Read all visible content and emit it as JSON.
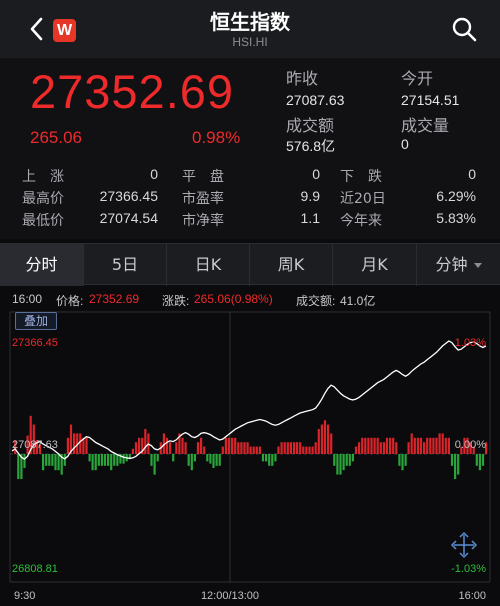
{
  "header": {
    "title": "恒生指数",
    "code": "HSI.HI",
    "logo_text": "W",
    "back_icon": "chevron-left-icon",
    "search_icon": "search-icon"
  },
  "quote": {
    "price": "27352.69",
    "change": "265.06",
    "change_pct": "0.98%",
    "prev_close_label": "昨收",
    "prev_close": "27087.63",
    "open_label": "今开",
    "open": "27154.51",
    "turnover_label": "成交额",
    "turnover": "576.8亿",
    "volume_label": "成交量",
    "volume": "0"
  },
  "stats": {
    "up_label": "上　涨",
    "up": "0",
    "flat_label": "平　盘",
    "flat": "0",
    "down_label": "下　跌",
    "down": "0",
    "high_label": "最高价",
    "high": "27366.45",
    "pe_label": "市盈率",
    "pe": "9.9",
    "d20_label": "近20日",
    "d20": "6.29%",
    "low_label": "最低价",
    "low": "27074.54",
    "pb_label": "市净率",
    "pb": "1.1",
    "ytd_label": "今年来",
    "ytd": "5.83%"
  },
  "tabs": [
    {
      "label": "分时",
      "active": true
    },
    {
      "label": "5日"
    },
    {
      "label": "日K"
    },
    {
      "label": "周K"
    },
    {
      "label": "月K"
    },
    {
      "label": "分钟"
    }
  ],
  "infobar": {
    "time": "16:00",
    "price_label": "价格:",
    "price": "27352.69",
    "change_label": "涨跌:",
    "change": "265.06(0.98%)",
    "turnover_label": "成交额:",
    "turnover": "41.0亿"
  },
  "chart_overlay_button": "叠加",
  "chart_data": {
    "type": "line",
    "y_max_label": "27366.45",
    "y_mid_label": "27087.63",
    "y_min_label": "26808.81",
    "pct_max_label": "1.03%",
    "pct_mid_label": "0.00%",
    "pct_min_label": "-1.03%",
    "x_labels": [
      "9:30",
      "12:00/13:00",
      "16:00"
    ],
    "ylim": [
      26808.81,
      27366.45
    ],
    "series": [
      {
        "values": [
          27095,
          27100,
          27090,
          27080,
          27075,
          27082,
          27098,
          27110,
          27115,
          27118,
          27112,
          27108,
          27104,
          27100,
          27094,
          27088,
          27080,
          27076,
          27082,
          27094,
          27102,
          27110,
          27118,
          27124,
          27130,
          27128,
          27122,
          27116,
          27112,
          27108,
          27104,
          27100,
          27094,
          27090,
          27086,
          27083,
          27080,
          27078,
          27077,
          27078,
          27082,
          27088,
          27094,
          27104,
          27112,
          27108,
          27100,
          27098,
          27102,
          27110,
          27116,
          27120,
          27118,
          27122,
          27130,
          27136,
          27140,
          27136,
          27130,
          27128,
          27132,
          27138,
          27140,
          27138,
          27135,
          27130,
          27126,
          27122,
          27124,
          27130,
          27136,
          27142,
          27148,
          27152,
          27156,
          27160,
          27164,
          27166,
          27168,
          27170,
          27172,
          27170,
          27168,
          27164,
          27160,
          27158,
          27160,
          27164,
          27168,
          27172,
          27176,
          27180,
          27184,
          27188,
          27190,
          27192,
          27194,
          27196,
          27200,
          27210,
          27222,
          27236,
          27248,
          27256,
          27252,
          27244,
          27236,
          27230,
          27226,
          27222,
          27220,
          27222,
          27226,
          27232,
          27238,
          27244,
          27250,
          27256,
          27262,
          27266,
          27270,
          27276,
          27282,
          27288,
          27292,
          27288,
          27282,
          27278,
          27282,
          27290,
          27296,
          27302,
          27308,
          27312,
          27318,
          27324,
          27330,
          27336,
          27344,
          27352,
          27358,
          27364,
          27360,
          27350,
          27342,
          27344,
          27350,
          27356,
          27360,
          27362,
          27358,
          27352,
          27348,
          27352
        ]
      }
    ]
  }
}
